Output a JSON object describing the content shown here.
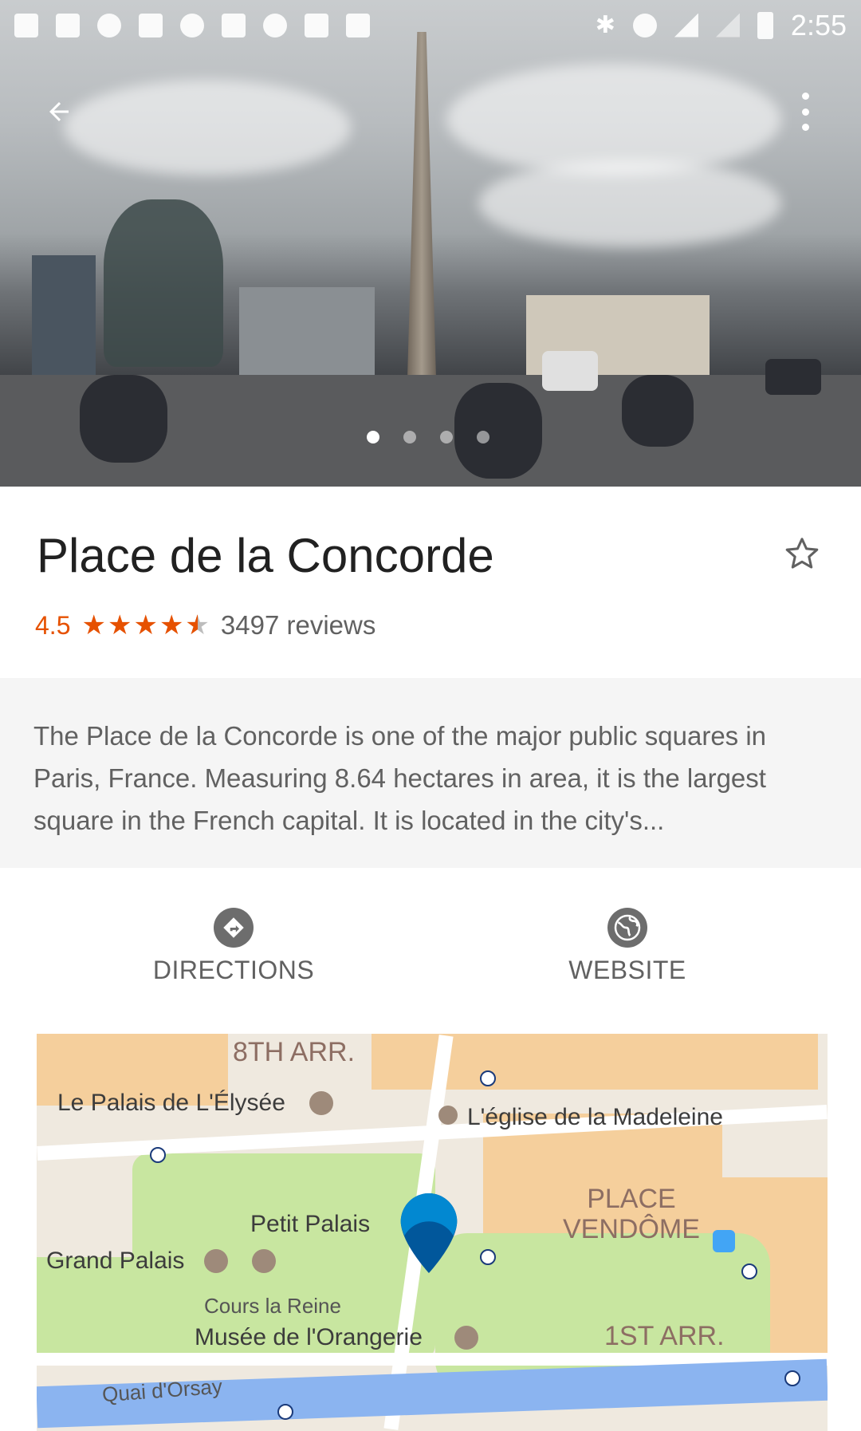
{
  "status_bar": {
    "time": "2:55"
  },
  "hero": {
    "image_alt": "Place de la Concorde photo",
    "page_count": 4,
    "active_page": 1
  },
  "place": {
    "name": "Place de la Concorde",
    "rating": "4.5",
    "rating_value": 4.5,
    "rating_max": 5,
    "reviews": "3497 reviews",
    "description": "The Place de la Concorde is one of the major public squares in Paris, France. Measuring 8.64 hectares in area, it is the largest square in the French capital. It is located in the city's..."
  },
  "actions": {
    "directions_label": "DIRECTIONS",
    "website_label": "WEBSITE"
  },
  "map": {
    "labels": {
      "arr8": "8TH ARR.",
      "elysee": "Le Palais de L'Élysée",
      "madeleine": "L'église de la Madeleine",
      "vendome": "PLACE\nVENDÔME",
      "petit_palais": "Petit Palais",
      "grand_palais": "Grand Palais",
      "cours": "Cours la Reine",
      "orangerie": "Musée de l'Orangerie",
      "arr1": "1ST ARR.",
      "quai": "Quai d'Orsay"
    }
  },
  "colors": {
    "accent": "#e65100",
    "pin": "#0277bd"
  }
}
